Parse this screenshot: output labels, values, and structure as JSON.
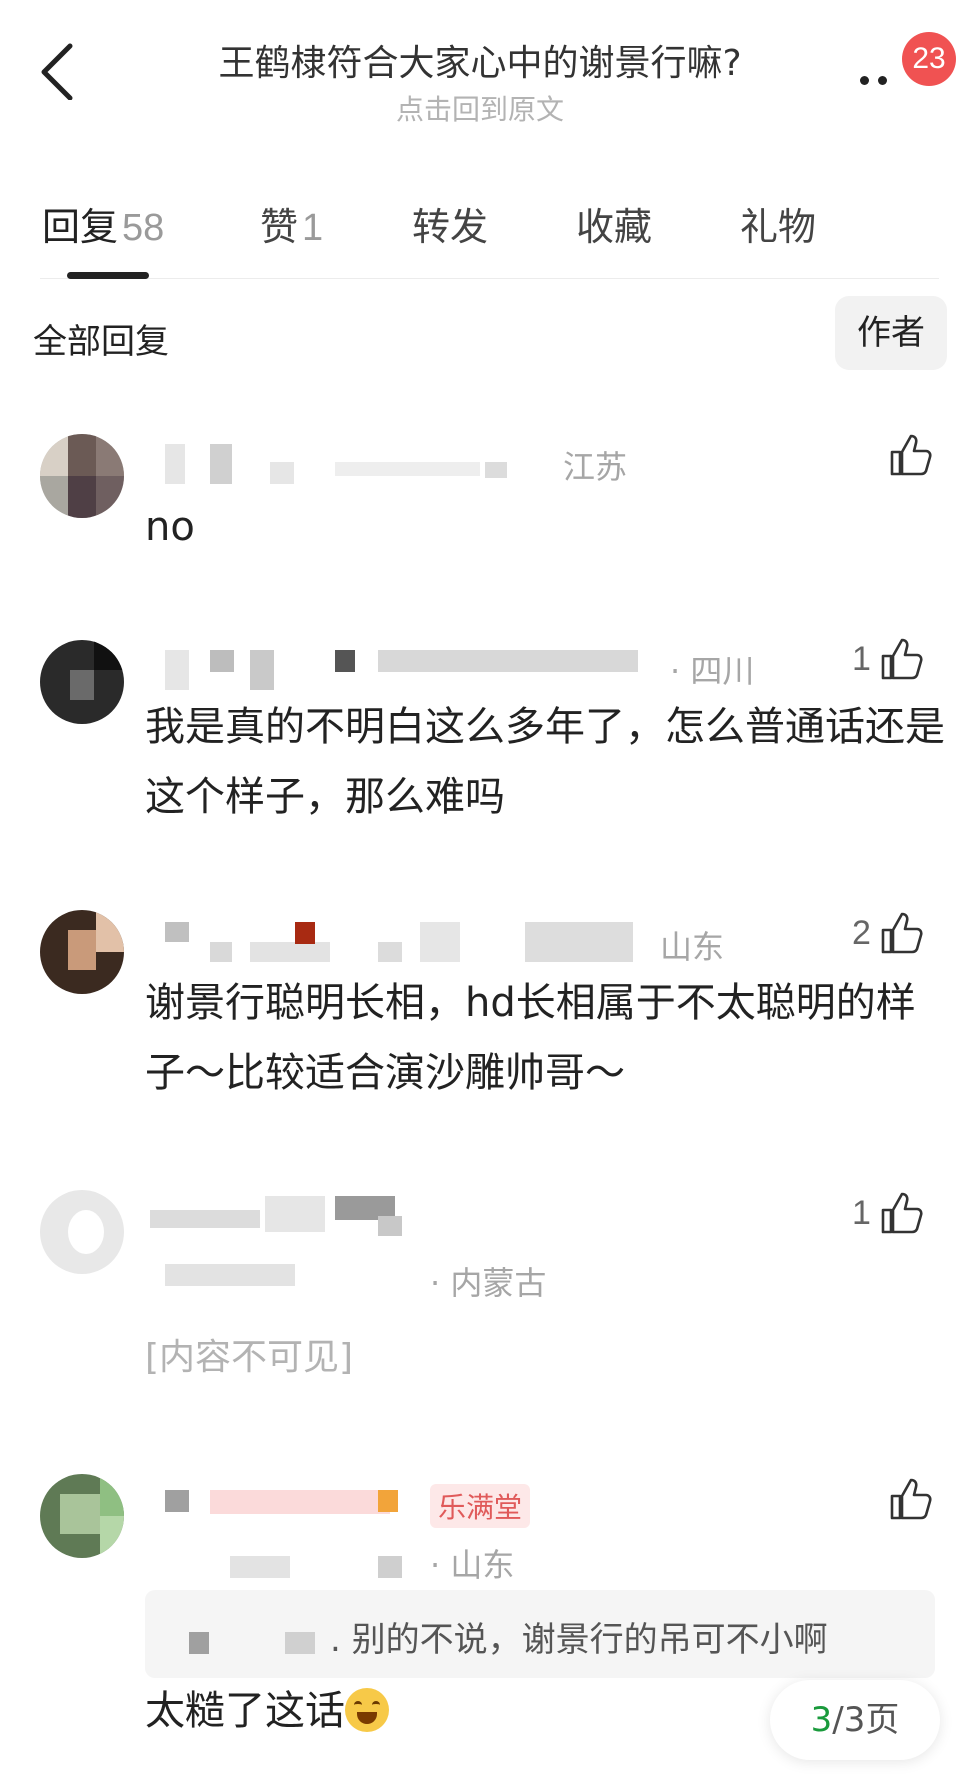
{
  "header": {
    "title": "王鹤棣符合大家心中的谢景行嘛?",
    "subtitle": "点击回到原文",
    "notification_count": "23"
  },
  "tabs": [
    {
      "label": "回复",
      "count": "58"
    },
    {
      "label": "赞",
      "count": "1"
    },
    {
      "label": "转发",
      "count": ""
    },
    {
      "label": "收藏",
      "count": ""
    },
    {
      "label": "礼物",
      "count": ""
    }
  ],
  "filter": {
    "all_replies": "全部回复",
    "author_button": "作者"
  },
  "comments": [
    {
      "location": "江苏",
      "likes": "",
      "text": "no"
    },
    {
      "location": "· 四川",
      "likes": "1",
      "text": "我是真的不明白这么多年了，怎么普通话还是这个样子，那么难吗"
    },
    {
      "location": "山东",
      "likes": "2",
      "text": "谢景行聪明长相，hd长相属于不太聪明的样子～比较适合演沙雕帅哥～"
    },
    {
      "location": "· 内蒙古",
      "likes": "1",
      "text": "[内容不可见]"
    },
    {
      "location": "· 山东",
      "likes": "",
      "badge": "乐满堂",
      "quote": ". 别的不说，谢景行的吊可不小啊",
      "text": "太糙了这话"
    }
  ],
  "pager": {
    "current": "3",
    "total": "/3页"
  },
  "colors": {
    "badge": "#f05252",
    "pager_current": "#1a9a3c"
  }
}
